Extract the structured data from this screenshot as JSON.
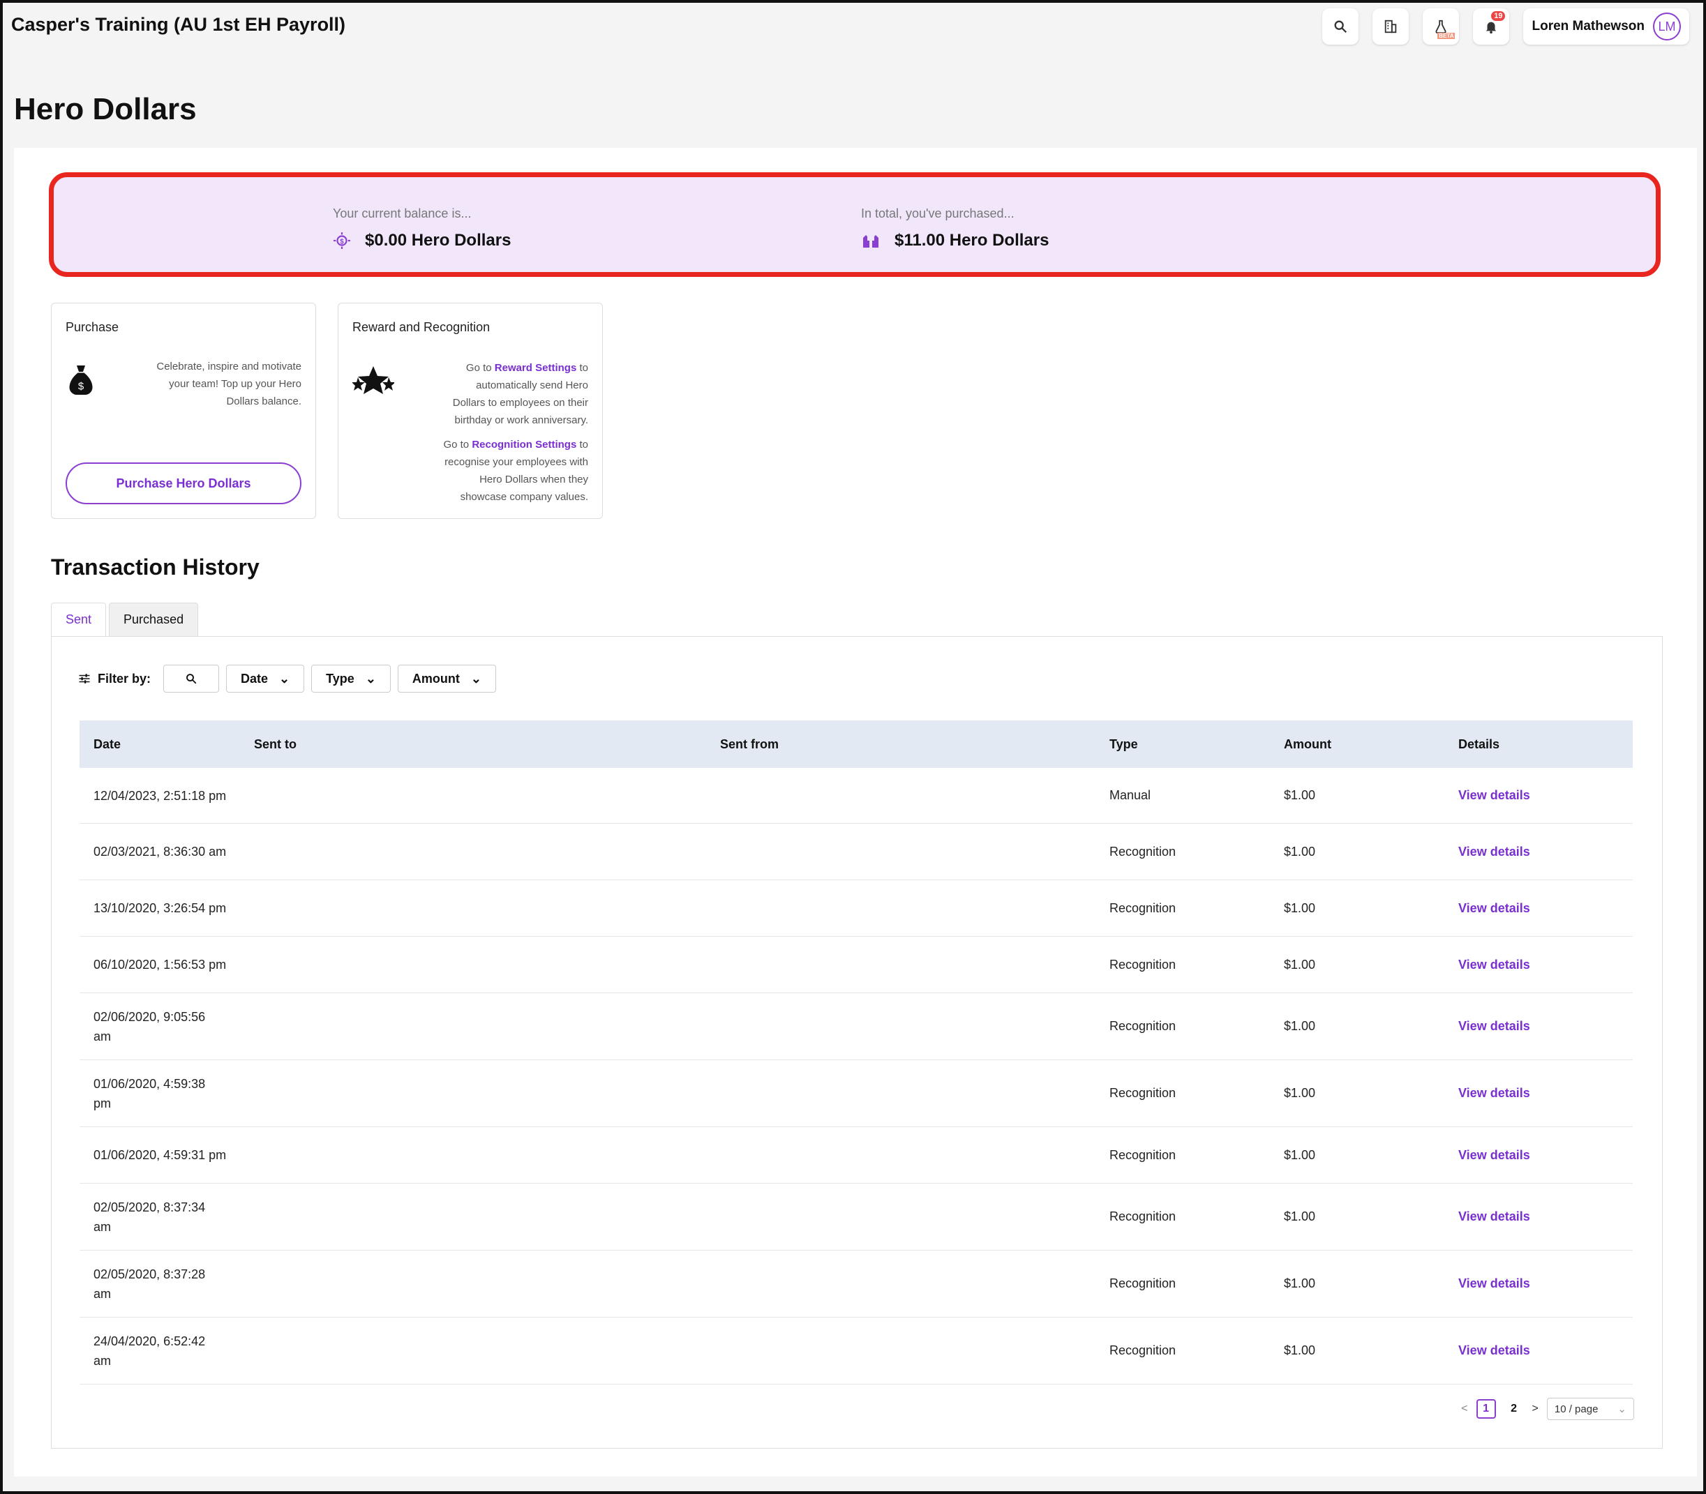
{
  "header": {
    "org_title": "Casper's Training (AU 1st EH Payroll)",
    "notification_count": "19",
    "beta_label": "BETA",
    "user_name": "Loren Mathewson",
    "user_initials": "LM"
  },
  "page": {
    "title": "Hero Dollars"
  },
  "balance": {
    "current_label": "Your current balance is...",
    "current_value": "$0.00 Hero Dollars",
    "total_label": "In total, you've purchased...",
    "total_value": "$11.00 Hero Dollars"
  },
  "cards": {
    "purchase": {
      "title": "Purchase",
      "text": "Celebrate, inspire and motivate your team! Top up your Hero Dollars balance.",
      "button_label": "Purchase Hero Dollars"
    },
    "reward": {
      "title": "Reward and Recognition",
      "p1_pre": "Go to ",
      "p1_link": "Reward Settings",
      "p1_post": " to automatically send Hero Dollars to employees on their birthday or work anniversary.",
      "p2_pre": "Go to ",
      "p2_link": "Recognition Settings",
      "p2_post": " to recognise your employees with Hero Dollars when they showcase company values."
    }
  },
  "history": {
    "title": "Transaction History",
    "tabs": [
      "Sent",
      "Purchased"
    ],
    "filter_label": "Filter by:",
    "filters": [
      "Date",
      "Type",
      "Amount"
    ],
    "columns": [
      "Date",
      "Sent to",
      "Sent from",
      "Type",
      "Amount",
      "Details"
    ],
    "rows": [
      {
        "date": "12/04/2023, 2:51:18 pm",
        "type": "Manual",
        "amount": "$1.00",
        "details": "View details"
      },
      {
        "date": "02/03/2021, 8:36:30 am",
        "type": "Recognition",
        "amount": "$1.00",
        "details": "View details"
      },
      {
        "date": "13/10/2020, 3:26:54 pm",
        "type": "Recognition",
        "amount": "$1.00",
        "details": "View details"
      },
      {
        "date": "06/10/2020, 1:56:53 pm",
        "type": "Recognition",
        "amount": "$1.00",
        "details": "View details"
      },
      {
        "date": "02/06/2020, 9:05:56 am",
        "type": "Recognition",
        "amount": "$1.00",
        "details": "View details"
      },
      {
        "date": "01/06/2020, 4:59:38 pm",
        "type": "Recognition",
        "amount": "$1.00",
        "details": "View details"
      },
      {
        "date": "01/06/2020, 4:59:31 pm",
        "type": "Recognition",
        "amount": "$1.00",
        "details": "View details"
      },
      {
        "date": "02/05/2020, 8:37:34 am",
        "type": "Recognition",
        "amount": "$1.00",
        "details": "View details"
      },
      {
        "date": "02/05/2020, 8:37:28 am",
        "type": "Recognition",
        "amount": "$1.00",
        "details": "View details"
      },
      {
        "date": "24/04/2020, 6:52:42 am",
        "type": "Recognition",
        "amount": "$1.00",
        "details": "View details"
      }
    ],
    "pagination": {
      "pages": [
        "1",
        "2"
      ],
      "current": "1",
      "page_size": "10 / page"
    }
  },
  "colors": {
    "accent": "#7a2fd0",
    "banner_bg": "#f1e6fa",
    "highlight_border": "#e8261f"
  }
}
